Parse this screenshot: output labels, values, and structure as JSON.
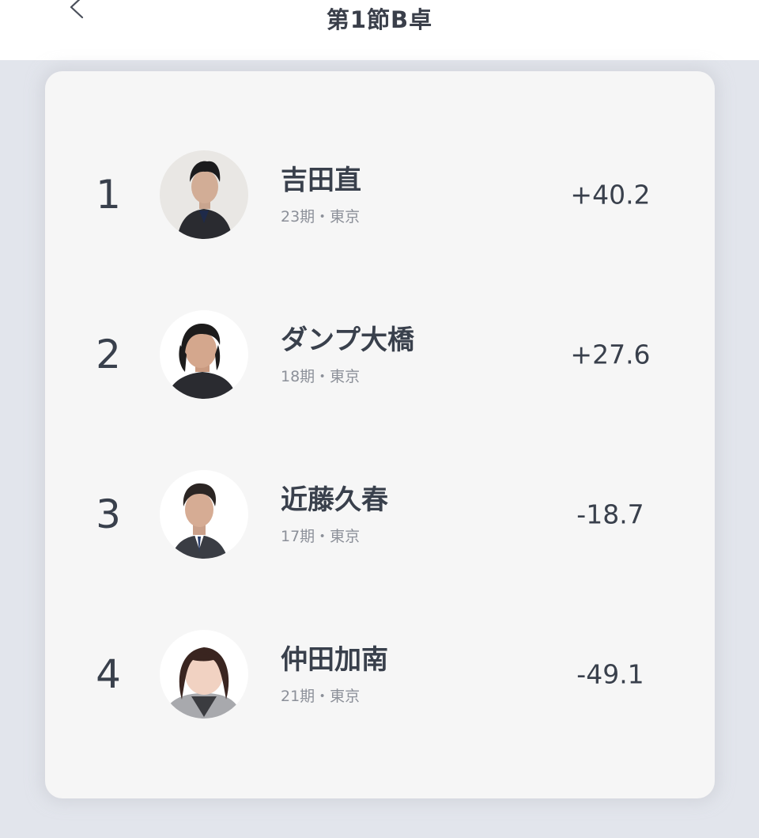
{
  "header": {
    "title": "第1節B卓",
    "back_icon": "chevron-left-icon"
  },
  "results": [
    {
      "rank": "1",
      "name": "吉田直",
      "info": "23期・東京",
      "score": "+40.2"
    },
    {
      "rank": "2",
      "name": "ダンプ大橋",
      "info": "18期・東京",
      "score": "+27.6"
    },
    {
      "rank": "3",
      "name": "近藤久春",
      "info": "17期・東京",
      "score": "-18.7"
    },
    {
      "rank": "4",
      "name": "仲田加南",
      "info": "21期・東京",
      "score": "-49.1"
    }
  ],
  "colors": {
    "page_background": "#e2e5ec",
    "card_background": "#f6f6f6",
    "text_primary": "#39404c",
    "text_secondary": "#8c9099"
  }
}
